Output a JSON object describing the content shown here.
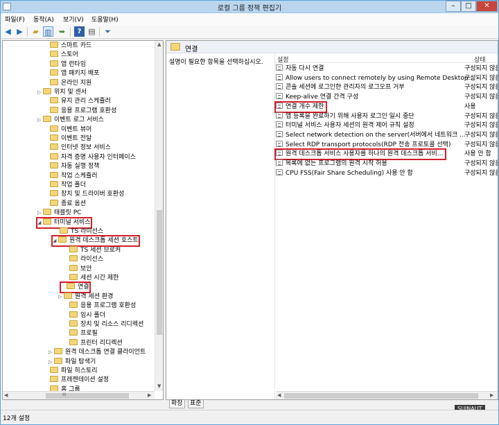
{
  "window": {
    "title": "로컬 그룹 정책 편집기",
    "min": "–",
    "max": "□",
    "close": "✕"
  },
  "menu": [
    "파일(F)",
    "동작(A)",
    "보기(V)",
    "도움말(H)"
  ],
  "toolbar_icons": [
    "back-arrow-icon",
    "forward-arrow-icon",
    "folder-up-icon",
    "show-hide-tree-icon",
    "export-list-icon",
    "help-icon",
    "properties-icon",
    "filter-icon"
  ],
  "tree": {
    "items": [
      {
        "label": "스마트 카드",
        "expander": ""
      },
      {
        "label": "스토어",
        "expander": ""
      },
      {
        "label": "앱 런타임",
        "expander": ""
      },
      {
        "label": "앱 패키지 배포",
        "expander": ""
      },
      {
        "label": "온라인 지원",
        "expander": ""
      },
      {
        "label": "위치 및 센서",
        "expander": "▷"
      },
      {
        "label": "유지 관리 스케쥴러",
        "expander": ""
      },
      {
        "label": "응용 프로그램 호환성",
        "expander": ""
      },
      {
        "label": "이벤트 로그 서비스",
        "expander": "▷"
      },
      {
        "label": "이벤트 뷰어",
        "expander": ""
      },
      {
        "label": "이벤트 전달",
        "expander": ""
      },
      {
        "label": "인터넷 정보 서비스",
        "expander": ""
      },
      {
        "label": "자격 증명 사용자 인터페이스",
        "expander": ""
      },
      {
        "label": "자동 실행 정책",
        "expander": ""
      },
      {
        "label": "작업 스케쥴러",
        "expander": ""
      },
      {
        "label": "작업 폴더",
        "expander": ""
      },
      {
        "label": "장치 및 드라이버 호환성",
        "expander": ""
      },
      {
        "label": "종료 옵션",
        "expander": ""
      },
      {
        "label": "태블릿 PC",
        "expander": "▷"
      },
      {
        "label": "터미널 서비스",
        "expander": "◢"
      },
      {
        "label": "TS 라이선스",
        "expander": ""
      },
      {
        "label": "원격 데스크톱 세션 호스트",
        "expander": "◢"
      },
      {
        "label": "TS 세션 브로커",
        "expander": ""
      },
      {
        "label": "라이선스",
        "expander": ""
      },
      {
        "label": "보안",
        "expander": ""
      },
      {
        "label": "세션 시간 제한",
        "expander": ""
      },
      {
        "label": "연결",
        "expander": ""
      },
      {
        "label": "원격 세션 환경",
        "expander": "▷"
      },
      {
        "label": "응용 프로그램 호환성",
        "expander": ""
      },
      {
        "label": "임시 폴더",
        "expander": ""
      },
      {
        "label": "장치 및 리소스 리디렉션",
        "expander": ""
      },
      {
        "label": "프로필",
        "expander": ""
      },
      {
        "label": "프린터 리디렉션",
        "expander": ""
      },
      {
        "label": "원격 데스크톱 연결 클라이언트",
        "expander": "▷"
      },
      {
        "label": "파일 탐색기",
        "expander": "▷"
      },
      {
        "label": "파일 히스토리",
        "expander": ""
      },
      {
        "label": "프레젠테이션 설정",
        "expander": ""
      },
      {
        "label": "홈 그룹",
        "expander": ""
      },
      {
        "label": "네트워크",
        "expander": "▷"
      }
    ],
    "scroll_up": "▲",
    "scroll_down": "▼",
    "scroll_left": "◀",
    "scroll_right": "▶",
    "grip": "III"
  },
  "right": {
    "header": "연결",
    "description": "설명이 필요한 항목을 선택하십시오.",
    "col_setting": "설정",
    "col_state": "상태",
    "rows": [
      {
        "name": "자동 다시 연결",
        "state": "구성되지 않음"
      },
      {
        "name": "Allow users to connect remotely by using Remote Desktop...",
        "state": "구성되지 않음"
      },
      {
        "name": "콘솔 세션에 로그인한 관리자의 로그오프 거부",
        "state": "구성되지 않음"
      },
      {
        "name": "Keep-alive 연결 간격 구성",
        "state": "구성되지 않음"
      },
      {
        "name": "연결 개수 제한",
        "state": "사용"
      },
      {
        "name": "앱 등록을 완료하기 위해 사용자 로그인 일시 중단",
        "state": "구성되지 않음"
      },
      {
        "name": "터미널 서비스 사용자 세션의 원격 제어 규칙 설정",
        "state": "구성되지 않음"
      },
      {
        "name": "Select network detection on the server(서버에서 네트워크 ...",
        "state": "구성되지 않음"
      },
      {
        "name": "Select RDP transport protocols(RDP 전송 프로토콜 선택)",
        "state": "구성되지 않음"
      },
      {
        "name": "원격 데스크톱 서비스 사용자를 하나의 원격 데스크톱 서비...",
        "state": "사용 안 함"
      },
      {
        "name": "목록에 없는 프로그램의 원격 시작 허용",
        "state": "구성되지 않음"
      },
      {
        "name": "CPU FSS(Fair Share Scheduling) 사용 안 함",
        "state": "구성되지 않음"
      }
    ]
  },
  "tabs": [
    "확장",
    "표준"
  ],
  "status": "12개 설정",
  "watermark": "SUINAUT"
}
